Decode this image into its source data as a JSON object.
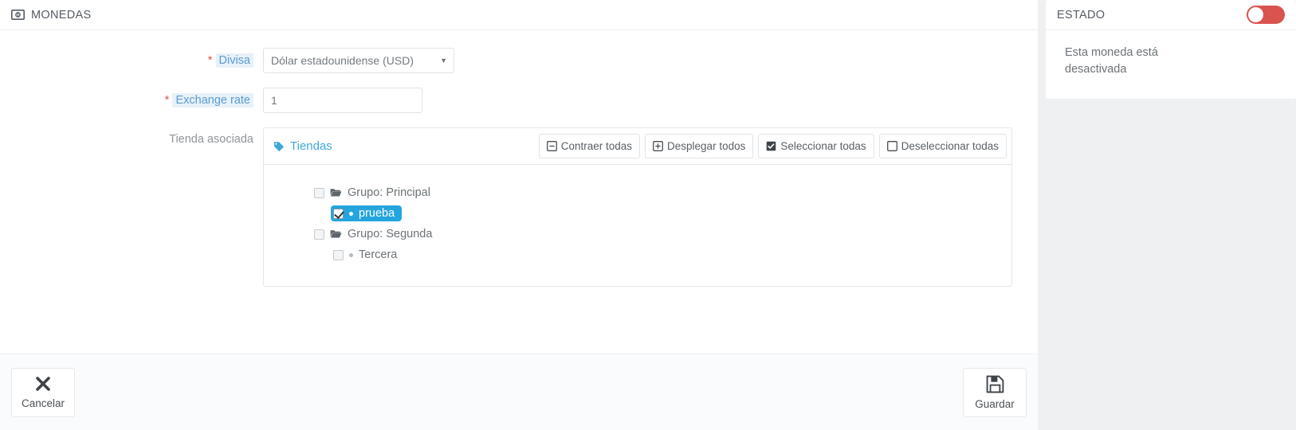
{
  "panel": {
    "header": {
      "icon": "money-bill-icon",
      "title": "MONEDAS"
    },
    "fields": {
      "divisa": {
        "label": "Divisa",
        "required_marker": "*",
        "selected": "Dólar estadounidense (USD)",
        "options": [
          "Dólar estadounidense (USD)"
        ],
        "caret": "▼"
      },
      "exchange_rate": {
        "label": "Exchange rate",
        "required_marker": "*",
        "value": "1",
        "placeholder": ""
      },
      "tienda_asociada": {
        "label": "Tienda asociada"
      }
    },
    "tree": {
      "title": "Tiendas",
      "title_icon": "tag-icon",
      "buttons": [
        {
          "label": "Contraer todas",
          "icon": "minus-square-icon"
        },
        {
          "label": "Desplegar todos",
          "icon": "plus-square-icon"
        },
        {
          "label": "Seleccionar todas",
          "icon": "checkbox-checked-icon"
        },
        {
          "label": "Deseleccionar todas",
          "icon": "checkbox-empty-icon"
        }
      ],
      "nodes": [
        {
          "label": "Grupo: Principal",
          "type": "group",
          "icon": "folder-open-icon",
          "checked": false,
          "selected": false,
          "depth": 0
        },
        {
          "label": "prueba",
          "type": "shop",
          "icon": "bullet-icon",
          "checked": true,
          "selected": true,
          "depth": 1
        },
        {
          "label": "Grupo: Segunda",
          "type": "group",
          "icon": "folder-open-icon",
          "checked": false,
          "selected": false,
          "depth": 0
        },
        {
          "label": "Tercera",
          "type": "shop",
          "icon": "bullet-icon",
          "checked": false,
          "selected": false,
          "depth": 1
        }
      ]
    },
    "footer": {
      "cancel": {
        "label": "Cancelar",
        "icon": "times-icon"
      },
      "save": {
        "label": "Guardar",
        "icon": "floppy-save-icon"
      }
    }
  },
  "sidebar": {
    "status": {
      "title": "ESTADO",
      "toggle_on": false,
      "toggle_color": "#d9534f",
      "message": "Esta moneda está desactivada"
    }
  },
  "colors": {
    "accent_blue": "#3fa7dc",
    "selected_blue": "#24a5dd",
    "required_red": "#e2574c",
    "toggle_red": "#d9534f",
    "label_highlight_bg": "#e8f1f8",
    "label_highlight_fg": "#5b9bd1",
    "page_bg": "#eff0f1"
  }
}
